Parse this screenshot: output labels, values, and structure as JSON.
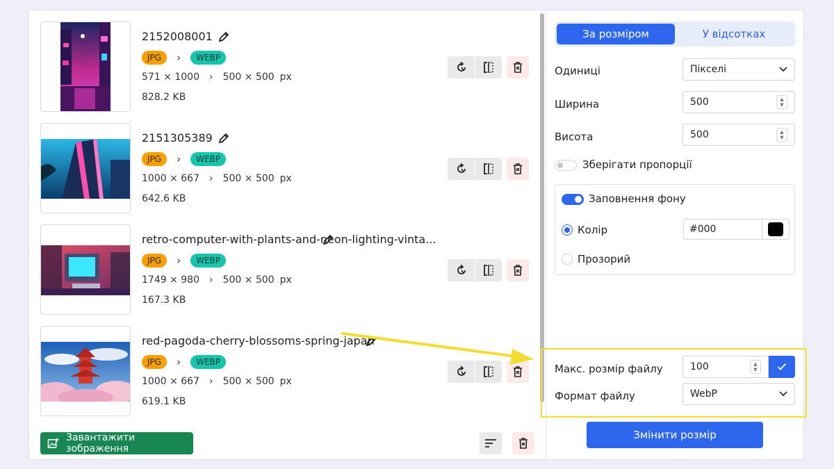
{
  "files": [
    {
      "name": "2152008001",
      "from": "JPG",
      "to": "WEBP",
      "orig_dims": "571 × 1000",
      "new_dims": "500 × 500",
      "unit": "px",
      "size": "828.2 KB"
    },
    {
      "name": "2151305389",
      "from": "JPG",
      "to": "WEBP",
      "orig_dims": "1000 × 667",
      "new_dims": "500 × 500",
      "unit": "px",
      "size": "642.6 KB"
    },
    {
      "name": "retro-computer-with-plants-and-neon-lighting-vinta...",
      "from": "JPG",
      "to": "WEBP",
      "orig_dims": "1749 × 980",
      "new_dims": "500 × 500",
      "unit": "px",
      "size": "167.3 KB"
    },
    {
      "name": "red-pagoda-cherry-blossoms-spring-japan",
      "from": "JPG",
      "to": "WEBP",
      "orig_dims": "1000 × 667",
      "new_dims": "500 × 500",
      "unit": "px",
      "size": "619.1 KB"
    }
  ],
  "upload_label": "Завантажити зображення",
  "tabs": {
    "by_size": "За розміром",
    "by_percent": "У відсотках",
    "active": "by_size"
  },
  "settings": {
    "units_label": "Одиниці",
    "units_value": "Пікселі",
    "width_label": "Ширина",
    "width_value": "500",
    "height_label": "Висота",
    "height_value": "500",
    "keep_ratio_label": "Зберігати пропорції",
    "keep_ratio_on": false,
    "fill_bg_label": "Заповнення фону",
    "fill_bg_on": true,
    "color_label": "Колір",
    "color_value": "#000",
    "transparent_label": "Прозорий",
    "max_size_label": "Макс. розмір файлу",
    "max_size_value": "100",
    "format_label": "Формат файлу",
    "format_value": "WebP"
  },
  "resize_button": "Змінити розмір",
  "colors": {
    "accent": "#2f66ee",
    "upload": "#198754",
    "jpg_badge": "#f5a000",
    "webp_badge": "#19c4ad",
    "highlight": "#f2dd33",
    "delete_bg": "#fde9ea",
    "delete_icon": "#d9323f"
  },
  "icons": [
    "pencil-icon",
    "rotate-icon",
    "flip-icon",
    "trash-icon",
    "sort-icon",
    "add-image-icon",
    "chevron-down-icon",
    "check-icon"
  ]
}
